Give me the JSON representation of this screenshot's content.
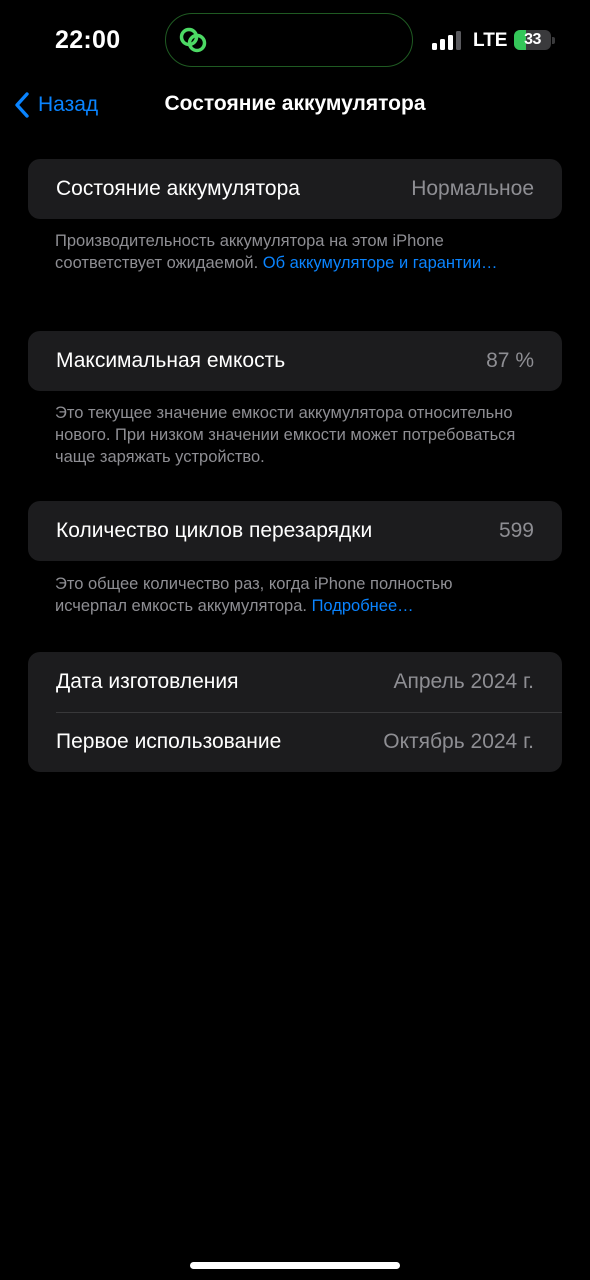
{
  "status_bar": {
    "time": "22:00",
    "network": "LTE",
    "battery_level": "33",
    "battery_percent": 33,
    "signal_bars_active": 3,
    "signal_bars_total": 4
  },
  "nav": {
    "back_label": "Назад",
    "title": "Состояние аккумулятора"
  },
  "health": {
    "label": "Состояние аккумулятора",
    "value": "Нормальное",
    "note": "Производительность аккумулятора на этом iPhone соответствует ожидаемой. ",
    "link": "Об аккумуляторе и гарантии…"
  },
  "capacity": {
    "label": "Максимальная емкость",
    "value": "87 %",
    "note": "Это текущее значение емкости аккумулятора относительно нового. При низком значении емкости может потребоваться чаще заряжать устройство."
  },
  "cycles": {
    "label": "Количество циклов перезарядки",
    "value": "599",
    "note": "Это общее количество раз, когда iPhone полностью исчерпал емкость аккумулятора. ",
    "link": "Подробнее…"
  },
  "dates": {
    "manufacture_label": "Дата изготовления",
    "manufacture_value": "Апрель 2024 г.",
    "first_use_label": "Первое использование",
    "first_use_value": "Октябрь 2024 г."
  },
  "colors": {
    "background": "#000000",
    "card": "#1c1c1e",
    "accent": "#0a84ff",
    "secondary_text": "#8e8e93",
    "battery_green": "#34c759"
  },
  "icons": {
    "back": "chevron-left-icon",
    "island": "link-rings-icon",
    "signal": "cellular-signal-icon",
    "battery": "battery-charging-icon"
  }
}
